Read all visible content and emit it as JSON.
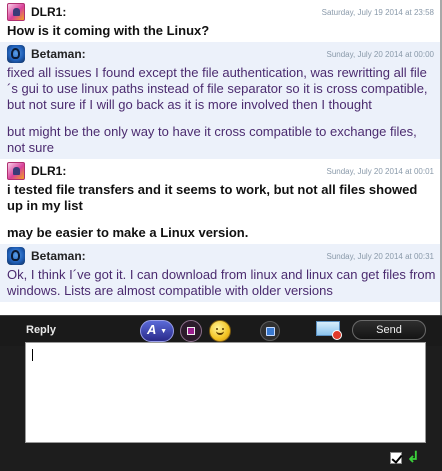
{
  "messages": [
    {
      "sender": "DLR1:",
      "timestamp": "Saturday, July 19 2014 at 23:58",
      "paragraphs": [
        "How is it coming with the Linux?"
      ],
      "avatar_icon": "dlr1-avatar"
    },
    {
      "sender": "Betaman:",
      "timestamp": "Sunday, July 20 2014 at 00:00",
      "paragraphs": [
        "fixed all issues I found except the file authentication,  was rewritting all file´s gui to use linux paths instead of file separator so it is cross compatible, but not sure if I will go back as it is more involved then I thought",
        "but might be the only way to have it cross compatible to exchange files, not sure"
      ],
      "avatar_icon": "betaman-avatar"
    },
    {
      "sender": "DLR1:",
      "timestamp": "Sunday, July 20 2014 at 00:01",
      "paragraphs": [
        "i tested file transfers and it seems to work, but not all files showed up in my list",
        "may be easier to make a Linux version."
      ],
      "avatar_icon": "dlr1-avatar"
    },
    {
      "sender": "Betaman:",
      "timestamp": "Sunday, July 20 2014 at 00:31",
      "paragraphs": [
        "Ok, I think I´ve got it.    I can download from linux and linux can get files from windows. Lists are almost compatible with older versions"
      ],
      "avatar_icon": "betaman-avatar"
    }
  ],
  "toolbar": {
    "reply_label": "Reply",
    "font_button_glyph": "A",
    "send_label": "Send"
  },
  "composer": {
    "value": "",
    "placeholder": ""
  },
  "footer": {
    "enter_glyph": "↲"
  },
  "colors": {
    "incoming_text": "#111111",
    "outgoing_text": "#4b2b6f",
    "outgoing_bg": "#ecf1fa",
    "timestamp": "#8a9aaa",
    "toolbar_bg": "#1a1a1a"
  }
}
